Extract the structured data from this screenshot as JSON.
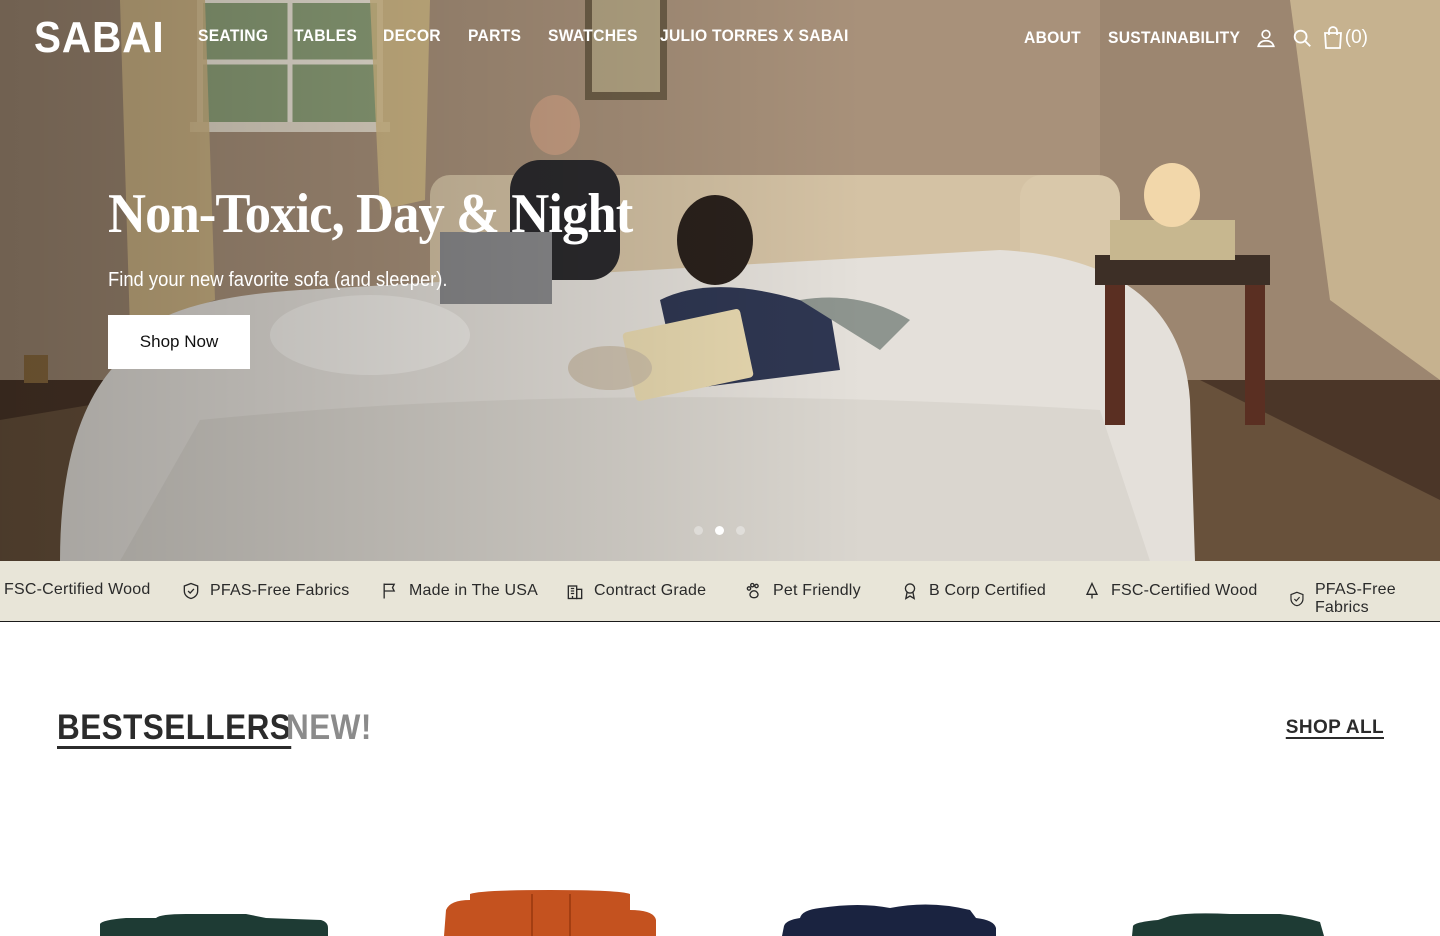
{
  "brand": {
    "logo": "SABAI"
  },
  "nav": {
    "primary": [
      "SEATING",
      "TABLES",
      "DECOR",
      "PARTS",
      "SWATCHES",
      "JULIO TORRES X SABAI"
    ],
    "about": "ABOUT",
    "sustainability": "SUSTAINABILITY",
    "cart_count": "(0)"
  },
  "hero": {
    "title": "Non-Toxic, Day & Night",
    "subtitle": "Find your new favorite sofa (and sleeper).",
    "cta": "Shop Now",
    "slides_total": 3,
    "active_slide": 2
  },
  "marquee": {
    "items": [
      {
        "label": "FSC-Certified Wood",
        "icon": "tree-icon"
      },
      {
        "label": "PFAS-Free Fabrics",
        "icon": "shield-check-icon"
      },
      {
        "label": "Made in The USA",
        "icon": "flag-icon"
      },
      {
        "label": "Contract Grade",
        "icon": "building-icon"
      },
      {
        "label": "Pet Friendly",
        "icon": "paw-icon"
      },
      {
        "label": "B Corp Certified",
        "icon": "award-icon"
      },
      {
        "label": "FSC-Certified Wood",
        "icon": "tree-icon"
      },
      {
        "label": "PFAS-Free Fabrics",
        "icon": "shield-check-icon"
      }
    ]
  },
  "products_section": {
    "tab_active": "BESTSELLERS",
    "tab_inactive": "NEW!",
    "shop_all": "SHOP ALL"
  },
  "colors": {
    "marquee_bg": "#e8e5d8",
    "sofa_green": "#1e3b34",
    "sofa_orange": "#c4521f",
    "sofa_navy": "#1a2340"
  }
}
